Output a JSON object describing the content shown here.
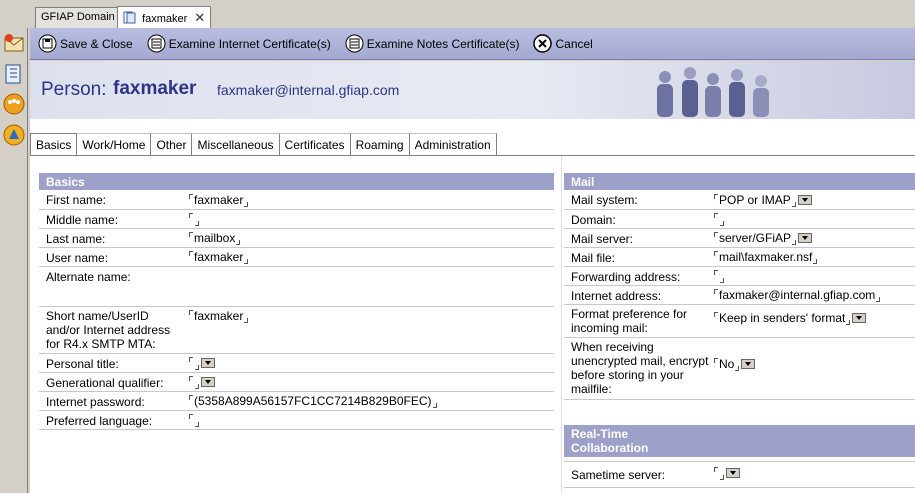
{
  "window_tabs": [
    {
      "label": "GFIAP Domain"
    },
    {
      "label": "faxmaker"
    }
  ],
  "actions": {
    "save_close": "Save & Close",
    "examine_internet": "Examine Internet Certificate(s)",
    "examine_notes": "Examine Notes Certificate(s)",
    "cancel": "Cancel"
  },
  "header": {
    "prefix": "Person:",
    "name": "faxmaker",
    "email": "faxmaker@internal.gfiap.com"
  },
  "form_tabs": [
    "Basics",
    "Work/Home",
    "Other",
    "Miscellaneous",
    "Certificates",
    "Roaming",
    "Administration"
  ],
  "basics": {
    "title": "Basics",
    "first_name": {
      "label": "First name:",
      "value": "faxmaker"
    },
    "middle_name": {
      "label": "Middle name:",
      "value": ""
    },
    "last_name": {
      "label": "Last name:",
      "value": "mailbox"
    },
    "user_name": {
      "label": "User name:",
      "value": "faxmaker"
    },
    "alternate_name": {
      "label": "Alternate name:"
    },
    "short_name": {
      "label_l1": "Short name/UserID",
      "label_l2": "and/or Internet address",
      "label_l3": "for R4.x SMTP MTA:",
      "value": "faxmaker"
    },
    "personal_title": {
      "label": "Personal title:",
      "value": ""
    },
    "generational": {
      "label": "Generational qualifier:",
      "value": ""
    },
    "internet_password": {
      "label": "Internet password:",
      "value": "(5358A899A56157FC1CC7214B829B0FEC)"
    },
    "preferred_language": {
      "label": "Preferred language:",
      "value": ""
    }
  },
  "mail": {
    "title": "Mail",
    "mail_system": {
      "label": "Mail system:",
      "value": "POP or IMAP"
    },
    "domain": {
      "label": "Domain:",
      "value": ""
    },
    "mail_server": {
      "label": "Mail server:",
      "value": "server/GFiAP"
    },
    "mail_file": {
      "label": "Mail file:",
      "value": "mail\\faxmaker.nsf"
    },
    "forwarding": {
      "label": "Forwarding address:",
      "value": ""
    },
    "internet_address": {
      "label": "Internet address:",
      "value": "faxmaker@internal.gfiap.com"
    },
    "format_pref": {
      "label_l1": "Format preference for",
      "label_l2": "incoming mail:",
      "value": "Keep in senders' format"
    },
    "encrypt": {
      "label_l1": "When receiving",
      "label_l2": "unencrypted mail, encrypt",
      "label_l3": "before storing in your",
      "label_l4": "mailfile:",
      "value": "No"
    }
  },
  "rtc": {
    "title_l1": "Real-Time",
    "title_l2": "Collaboration",
    "sametime": {
      "label": "Sametime server:",
      "value": ""
    }
  }
}
